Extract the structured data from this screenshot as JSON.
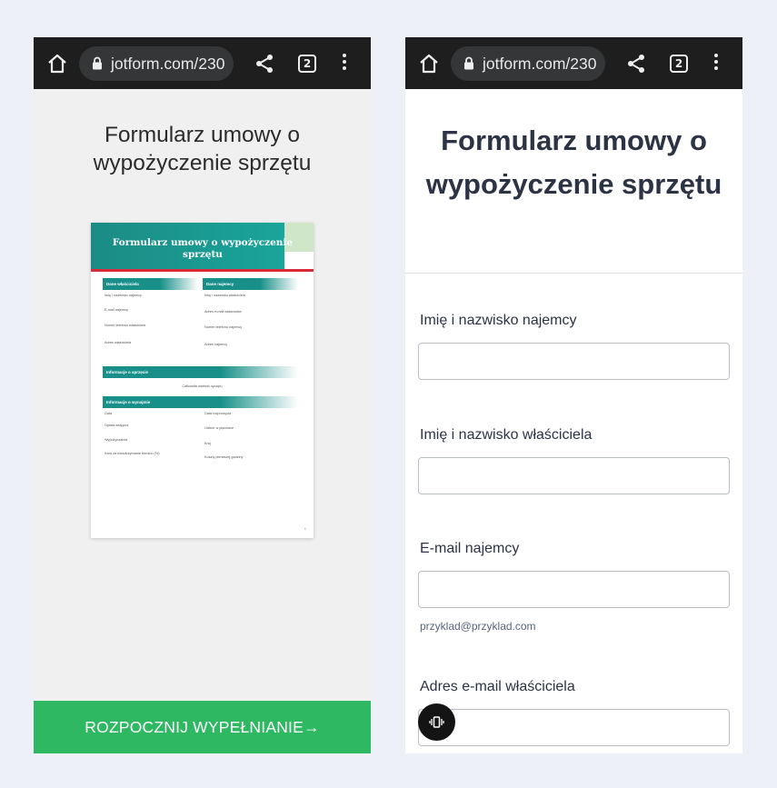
{
  "browser": {
    "url": "jotform.com/230",
    "tab_count": "2",
    "icons": [
      "home-icon",
      "lock-icon",
      "share-icon",
      "tabs-icon",
      "menu-icon"
    ]
  },
  "left_screen": {
    "title": "Formularz umowy o wypożyczenie sprzętu",
    "preview": {
      "heading": "Formularz umowy o wypożyczenie sprzętu",
      "sections": {
        "owner": "Dane właściciela",
        "renter": "Dane najemcy",
        "equipment": "Informacje o sprzęcie",
        "rental": "Informacje o wynajmie"
      },
      "owner_fields": [
        "Imię i nazwisko najemcy",
        "E-mail najemcy",
        "Numer telefonu właściciela",
        "Adres właściciela"
      ],
      "renter_fields": [
        "Imię i nazwisko właściciela",
        "Adres e-mail właściciela",
        "Numer telefonu najemcy",
        "Adres najemcy"
      ],
      "equipment_field": "Całkowita wartość sprzętu",
      "rental_left": [
        "Data",
        "Opłata wstępna",
        "Wypożyczalnia",
        "Kara za niedotrzymanie terminu (%)"
      ],
      "rental_right": [
        "Data rozpoczęcia",
        "Odbiór w placówce",
        "Kraj",
        "Koszty pierwszej godziny"
      ],
      "page_number": "1"
    },
    "start_button": "ROZPOCZNIJ WYPEŁNIANIE→"
  },
  "right_screen": {
    "title": "Formularz umowy o wypożyczenie sprzętu",
    "fields": {
      "renter_name": {
        "label": "Imię i nazwisko najemcy",
        "value": ""
      },
      "owner_name": {
        "label": "Imię i nazwisko właściciela",
        "value": ""
      },
      "renter_email": {
        "label": "E-mail najemcy",
        "value": "",
        "hint": "przyklad@przyklad.com"
      },
      "owner_email": {
        "label": "Adres e-mail właściciela",
        "value": ""
      }
    },
    "floating_icon": "vibrate-icon"
  },
  "colors": {
    "browser_bar": "#1e1e1e",
    "start_button": "#2db861",
    "preview_teal": "#188f89",
    "preview_red": "#d72b3a",
    "page_background": "#eef0f8"
  }
}
